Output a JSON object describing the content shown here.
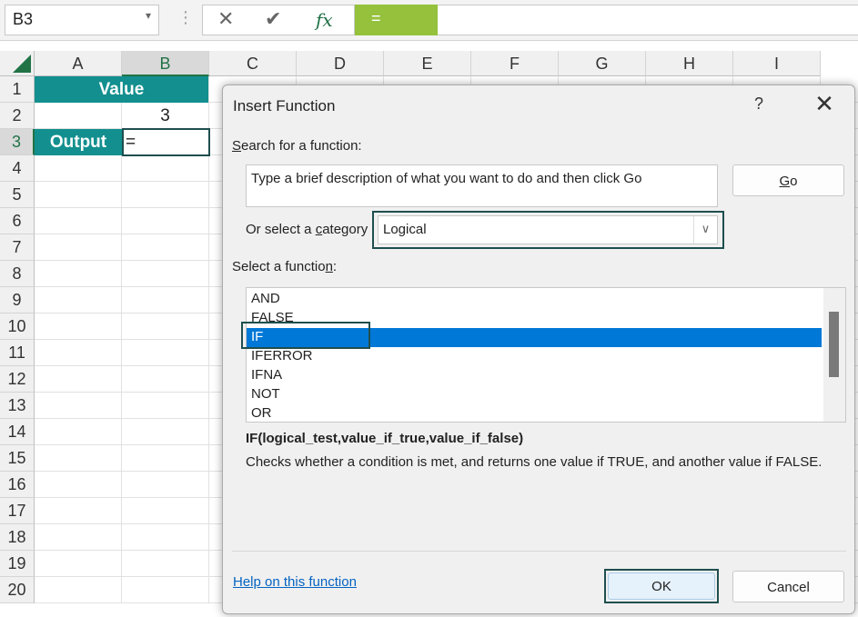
{
  "formula_bar": {
    "name_box": "B3",
    "cancel_icon": "✕",
    "enter_icon": "✔",
    "fx_icon": "fx",
    "formula": "="
  },
  "grid": {
    "columns": [
      "A",
      "B",
      "C",
      "D",
      "E",
      "F",
      "G",
      "H",
      "I"
    ],
    "rows": [
      "1",
      "2",
      "3",
      "4",
      "5",
      "6",
      "7",
      "8",
      "9",
      "10",
      "11",
      "12",
      "13",
      "14",
      "15",
      "16",
      "17",
      "18",
      "19",
      "20"
    ],
    "selected_column": "B",
    "selected_row": "3",
    "cells": {
      "A1B1": "Value",
      "B2": "3",
      "A3": "Output",
      "B3": "="
    }
  },
  "dialog": {
    "title": "Insert Function",
    "help_icon": "?",
    "close_icon": "✕",
    "search_label_pre": "",
    "search_label_key": "S",
    "search_label_post": "earch for a function:",
    "search_value": "Type a brief description of what you want to do and then click Go",
    "go_key": "G",
    "go_rest": "o",
    "category_label_pre": "Or select a ",
    "category_label_key": "c",
    "category_label_post": "ategory",
    "category_value": "Logical",
    "function_label_pre": "Select a functio",
    "function_label_key": "n",
    "function_label_post": ":",
    "functions": [
      "AND",
      "FALSE",
      "IF",
      "IFERROR",
      "IFNA",
      "NOT",
      "OR"
    ],
    "selected_function": "IF",
    "syntax": "IF(logical_test,value_if_true,value_if_false)",
    "description": "Checks whether a condition is met, and returns one value if TRUE, and another value if FALSE.",
    "help_link": "Help on this function",
    "ok_label": "OK",
    "cancel_label": "Cancel"
  },
  "colors": {
    "teal_fill": "#138f8f",
    "formula_green": "#95c13d",
    "selection_blue": "#0078d7",
    "frame_dark": "#1f4e4e"
  }
}
